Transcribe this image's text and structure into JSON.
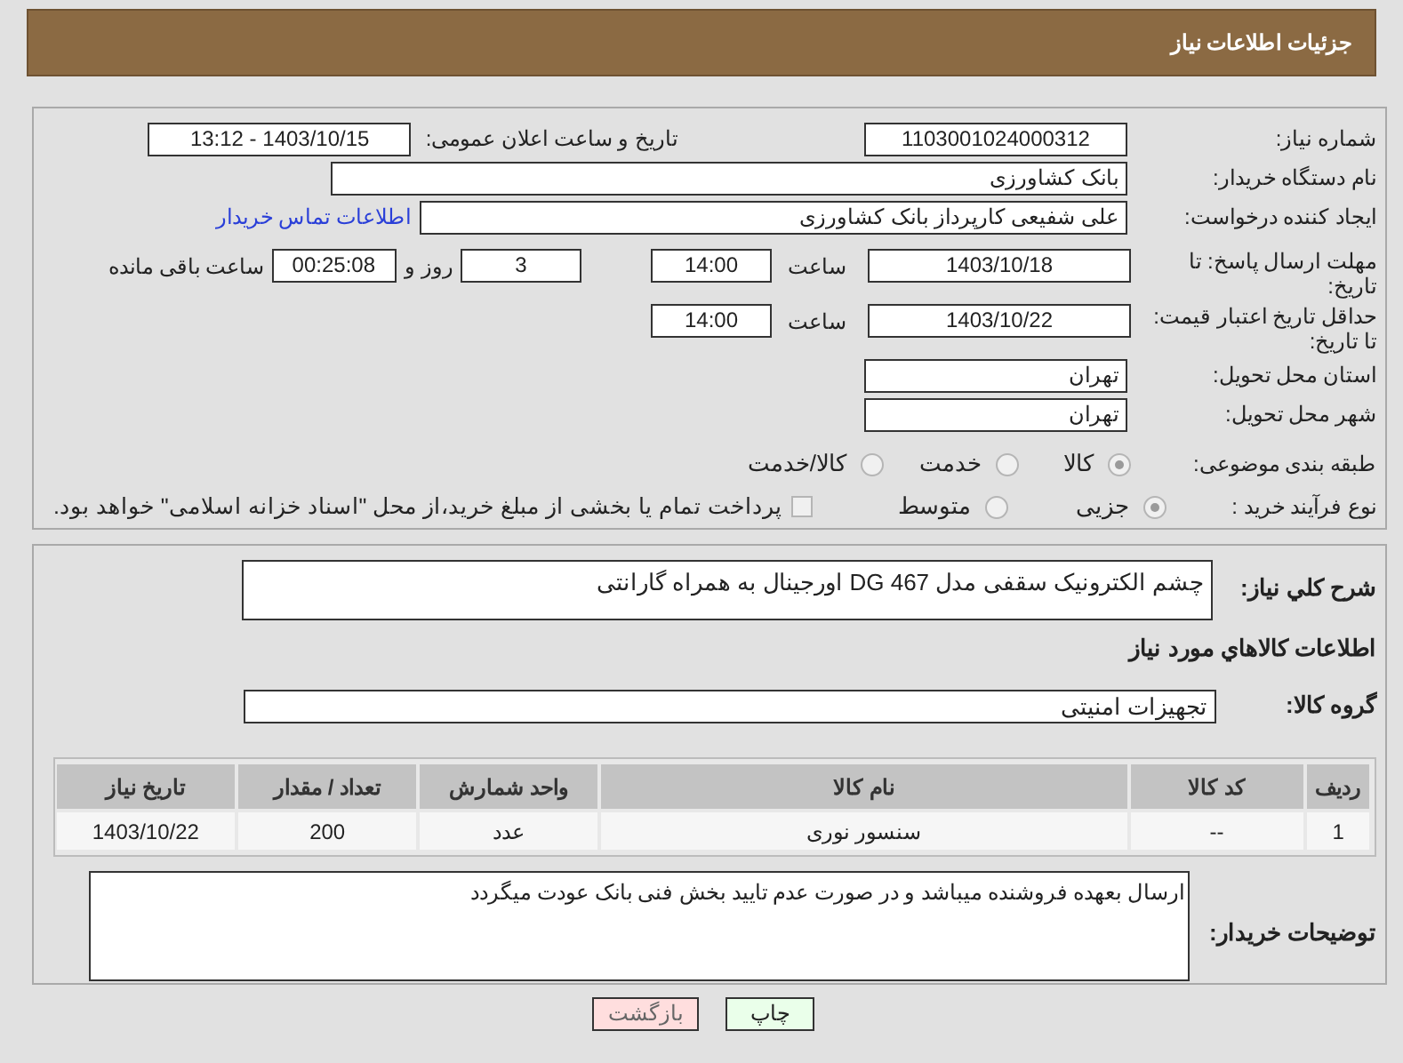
{
  "header": {
    "title": "جزئیات اطلاعات نیاز"
  },
  "need_number": {
    "label": "شماره نیاز:",
    "value": "1103001024000312"
  },
  "announce": {
    "label": "تاریخ و ساعت اعلان عمومی:",
    "value": "1403/10/15 - 13:12"
  },
  "buyer_org": {
    "label": "نام دستگاه خریدار:",
    "value": "بانک کشاورزی"
  },
  "requester": {
    "label": "ایجاد کننده درخواست:",
    "value": "علی شفیعی کارپرداز بانک کشاورزی",
    "link": "اطلاعات تماس خریدار"
  },
  "reply_deadline": {
    "label": "مهلت ارسال پاسخ: تا تاریخ:",
    "date": "1403/10/18",
    "time_label": "ساعت",
    "time": "14:00",
    "days": "3",
    "days_label": "روز و",
    "remaining": "00:25:08",
    "remaining_label": "ساعت باقی مانده"
  },
  "price_validity": {
    "label": "حداقل تاریخ اعتبار قیمت: تا تاریخ:",
    "date": "1403/10/22",
    "time_label": "ساعت",
    "time": "14:00"
  },
  "province": {
    "label": "استان محل تحویل:",
    "value": "تهران"
  },
  "city": {
    "label": "شهر محل تحویل:",
    "value": "تهران"
  },
  "category": {
    "label": "طبقه بندی موضوعی:",
    "options": [
      {
        "label": "کالا",
        "selected": true
      },
      {
        "label": "خدمت",
        "selected": false
      },
      {
        "label": "کالا/خدمت",
        "selected": false
      }
    ]
  },
  "purchase_type": {
    "label": "نوع فرآیند خرید :",
    "options": [
      {
        "label": "جزیی",
        "selected": true
      },
      {
        "label": "متوسط",
        "selected": false
      }
    ],
    "checkbox": {
      "label": "پرداخت تمام یا بخشی از مبلغ خرید،از محل \"اسناد خزانه اسلامی\" خواهد بود.",
      "checked": false
    }
  },
  "description": {
    "label": "شرح کلي نياز:",
    "value": "چشم الکترونیک سقفی مدل DG 467 اورجینال به همراه گارانتی"
  },
  "goods_title": "اطلاعات کالاهاي مورد نياز",
  "goods_group": {
    "label": "گروه کالا:",
    "value": "تجهیزات امنیتی"
  },
  "table": {
    "columns": [
      "ردیف",
      "کد کالا",
      "نام کالا",
      "واحد شمارش",
      "تعداد / مقدار",
      "تاریخ نیاز"
    ],
    "rows": [
      [
        "1",
        "--",
        "سنسور نوری",
        "عدد",
        "200",
        "1403/10/22"
      ]
    ]
  },
  "buyer_notes": {
    "label": "توضیحات خریدار:",
    "value": "ارسال بعهده فروشنده میباشد و در صورت عدم تایید بخش فنی بانک عودت میگردد"
  },
  "buttons": [
    {
      "label": "چاپ",
      "kind": "print"
    },
    {
      "label": "بازگشت",
      "kind": "back"
    }
  ]
}
